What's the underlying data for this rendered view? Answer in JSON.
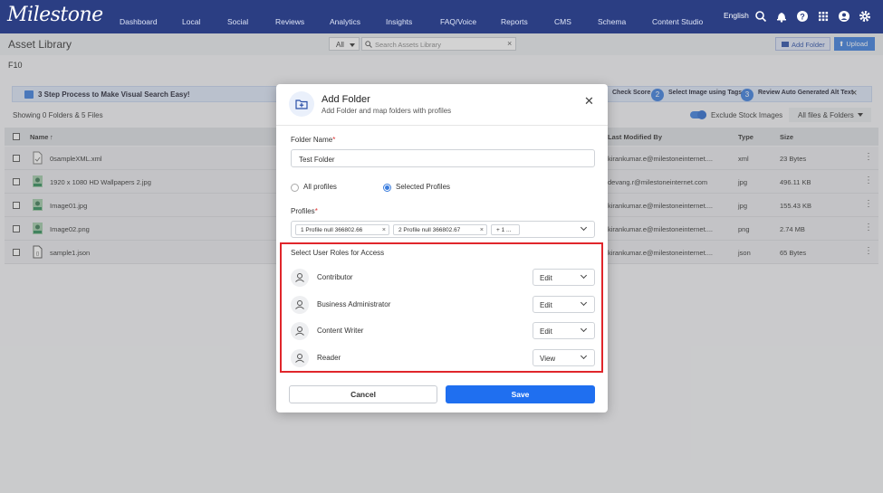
{
  "nav": {
    "logo": "Milestone",
    "items": [
      "Dashboard",
      "Local",
      "Social",
      "Reviews",
      "Analytics",
      "Insights",
      "FAQ/Voice",
      "Reports",
      "CMS",
      "Schema",
      "Content Studio"
    ],
    "language": "English"
  },
  "asset_bar": {
    "title": "Asset Library",
    "filter_value": "All",
    "search_placeholder": "Search Assets Library",
    "add_folder": "Add Folder",
    "upload": "Upload"
  },
  "breadcrumb": "F10",
  "banner": {
    "title": "3 Step Process to Make Visual Search Easy!",
    "step1_label": "Check Score",
    "step2_num": "2",
    "step2_label": "Select Image using Tags",
    "step3_num": "3",
    "step3_label": "Review Auto Generated Alt Text"
  },
  "list": {
    "showing": "Showing 0 Folders & 5 Files",
    "exclude_stock": "Exclude Stock Images",
    "view_filter": "All files & Folders",
    "headers": {
      "name": "Name",
      "modified_by": "Last Modified By",
      "type": "Type",
      "size": "Size"
    },
    "rows": [
      {
        "name": "0sampleXML.xml",
        "modified_by": "kirankumar.e@milestoneinternet....",
        "type": "xml",
        "size": "23 Bytes"
      },
      {
        "name": "1920 x 1080 HD Wallpapers 2.jpg",
        "modified_by": "devang.r@milestoneinternet.com",
        "type": "jpg",
        "size": "496.11 KB"
      },
      {
        "name": "Image01.jpg",
        "modified_by": "kirankumar.e@milestoneinternet....",
        "type": "jpg",
        "size": "155.43 KB"
      },
      {
        "name": "Image02.png",
        "modified_by": "kirankumar.e@milestoneinternet....",
        "type": "png",
        "size": "2.74 MB"
      },
      {
        "name": "sample1.json",
        "modified_by": "kirankumar.e@milestoneinternet....",
        "type": "json",
        "size": "65 Bytes"
      }
    ]
  },
  "modal": {
    "title": "Add Folder",
    "subtitle": "Add Folder and map folders with profiles",
    "folder_name_label": "Folder Name",
    "folder_name_value": "Test Folder",
    "radio_all": "All profiles",
    "radio_selected": "Selected Profiles",
    "profiles_label": "Profiles",
    "chips": [
      "1 Profile null 366802.66",
      "2 Profile null 366802.67",
      "+ 1 ..."
    ],
    "roles_title": "Select User Roles for Access",
    "roles": [
      {
        "name": "Contributor",
        "access": "Edit"
      },
      {
        "name": "Business Administrator",
        "access": "Edit"
      },
      {
        "name": "Content Writer",
        "access": "Edit"
      },
      {
        "name": "Reader",
        "access": "View"
      }
    ],
    "cancel": "Cancel",
    "save": "Save"
  },
  "colors": {
    "nav_bg": "#2b3e83",
    "primary": "#1f6ff0",
    "highlight_border": "#e0262b"
  }
}
